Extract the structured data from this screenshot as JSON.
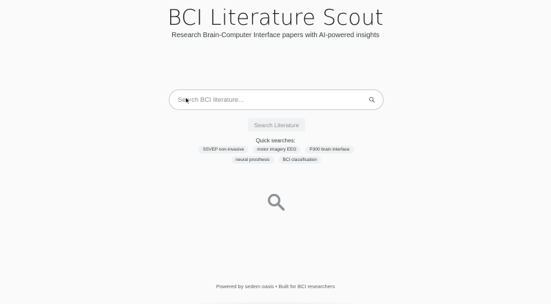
{
  "header": {
    "title": "BCI Literature Scout",
    "subtitle": "Research Brain-Computer Interface papers with AI-powered insights"
  },
  "search": {
    "placeholder": "Search BCI literature...",
    "value": "",
    "icon": "search-icon",
    "button_label": "Search Literature"
  },
  "quick_searches": {
    "label": "Quick searches:",
    "items": [
      "SSVEP non-invasive",
      "motor imagery EEG",
      "P300 brain interface",
      "neural prosthesis",
      "BCI classification"
    ]
  },
  "empty_state": {
    "icon": "magnifier-icon"
  },
  "footer": {
    "text": "Powered by sedem oasis • Built for BCI researchers"
  },
  "colors": {
    "background": "#fafafa",
    "title": "#1f1f1f",
    "chip_background": "#eef0f2",
    "button_background": "#f0f1f3",
    "empty_icon": "#8e9196"
  }
}
